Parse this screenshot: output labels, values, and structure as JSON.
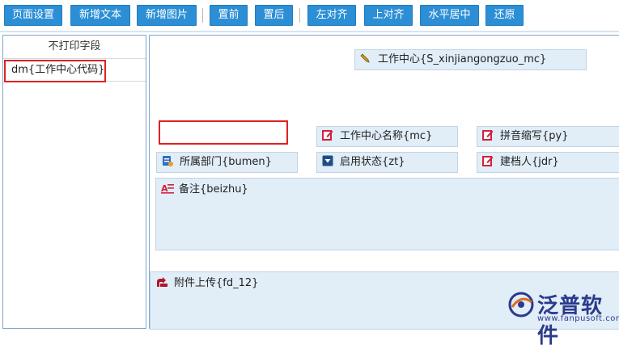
{
  "toolbar": {
    "page_settings": "页面设置",
    "add_text": "新增文本",
    "add_image": "新增图片",
    "bring_front": "置前",
    "send_back": "置后",
    "align_left": "左对齐",
    "align_top": "上对齐",
    "center_horizontal": "水平居中",
    "restore": "还原"
  },
  "left_panel": {
    "header": "不打印字段",
    "items": [
      {
        "label": "dm{工作中心代码}"
      }
    ]
  },
  "canvas": {
    "title_field": "工作中心{S_xinjiangongzuo_mc}",
    "name_field": "工作中心名称{mc}",
    "pinyin_field": "拼音缩写{py}",
    "dept_field": "所属部门{bumen}",
    "status_field": "启用状态{zt}",
    "creator_field": "建档人{jdr}",
    "remark_field": "备注{beizhu}",
    "attachment_field": "附件上传{fd_12}"
  },
  "watermark": {
    "brand": "泛普软件",
    "url": "www.fanpusoft.com"
  },
  "colors": {
    "button_blue": "#2c8fd5",
    "highlight_red": "#e02020",
    "field_bg": "#e1edf7",
    "brand_navy": "#2a3a8c"
  },
  "icons": [
    "pen-icon",
    "edit-icon",
    "form-icon",
    "dropdown-icon",
    "text-area-icon",
    "attachment-icon",
    "fanpu-logo-icon"
  ]
}
